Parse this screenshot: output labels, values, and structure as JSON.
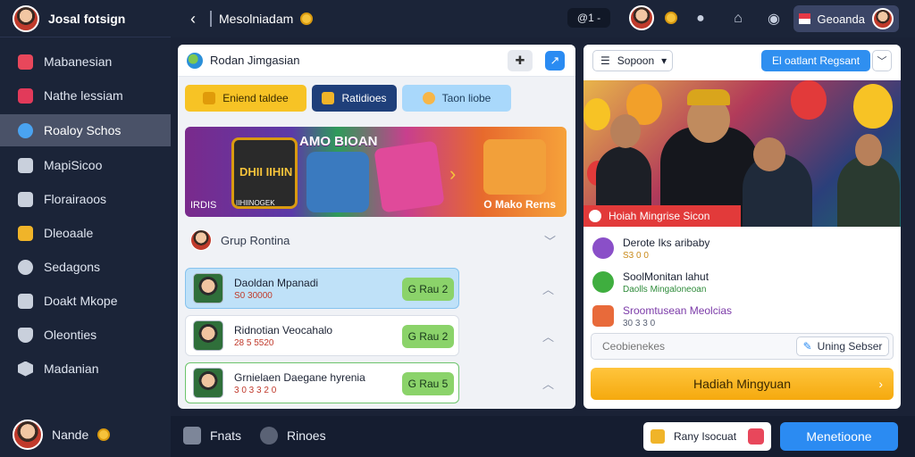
{
  "app": {
    "brand": "Josal fotsign",
    "accent": "#2b8bf2"
  },
  "sidebar": {
    "items": [
      {
        "label": "Mabanesian",
        "icon": "play-icon"
      },
      {
        "label": "Nathe lessiam",
        "icon": "mail-icon"
      },
      {
        "label": "Roaloy Schos",
        "icon": "globe-icon",
        "active": true
      },
      {
        "label": "MapiSicoo",
        "icon": "document-icon"
      },
      {
        "label": "Florairaoos",
        "icon": "puzzle-icon"
      },
      {
        "label": "Dleoaale",
        "icon": "folder-icon"
      },
      {
        "label": "Sedagons",
        "icon": "gear-icon"
      },
      {
        "label": "Doakt Mkope",
        "icon": "tools-icon"
      },
      {
        "label": "Oleonties",
        "icon": "shield-icon"
      },
      {
        "label": "Madanian",
        "icon": "hex-icon"
      }
    ],
    "user": {
      "name": "Nande"
    }
  },
  "topbar": {
    "title": "Mesolniadam",
    "pill": "@1 -",
    "user_button": "Geoanda"
  },
  "left_panel": {
    "title": "Rodan Jimgasian",
    "chips": [
      "Eniend taldee",
      "Ratidioes",
      "Taon liobe"
    ],
    "banner": {
      "title": "AMO BIOAN",
      "tile_text": "DHII IIHIN",
      "sub_left": "IRDIS",
      "sub_tile": "IIHIINOGEK",
      "right": "O Mako Rerns"
    },
    "group": {
      "title": "Grup Rontina"
    },
    "games": [
      {
        "name": "Daoldan Mpanadi",
        "meta": "S0 30000",
        "play": "G Rau 2"
      },
      {
        "name": "Ridnotian Veocahalo",
        "meta": "28 5 5520",
        "play": "G Rau 2"
      },
      {
        "name": "Grnielaen Daegane hyrenia",
        "meta": "3 0 3 3 2 0",
        "play": "G Rau 5"
      }
    ]
  },
  "right_panel": {
    "sort_label": "Sopoon",
    "cta_top": "El oatlant Regsant",
    "hero_tag": "Hoiah Mingrise Sicon",
    "info": [
      {
        "title": "Derote Iks aribaby",
        "sub": "S3 0 0",
        "color": "#c98a1a"
      },
      {
        "title": "SoolMonitan lahut",
        "sub": "Daolls Mingaloneoan",
        "color": "#2e8b3a"
      },
      {
        "title": "Sroomtusean Meolcias",
        "sub": "30 3 3 0",
        "color": "#7b3aa8"
      }
    ],
    "search_placeholder": "Ceobienekes",
    "search_button": "Uning Sebser",
    "big_cta": "Hadiah Mingyuan"
  },
  "bottombar": {
    "link1": "Fnats",
    "link2": "Rinoes",
    "white_button": "Rany Isocuat",
    "blue_button": "Menetioone"
  }
}
